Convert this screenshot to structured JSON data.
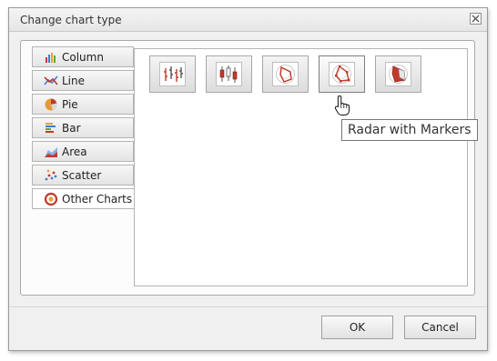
{
  "dialog": {
    "title": "Change chart type",
    "close_icon": "close-icon"
  },
  "tabs": [
    {
      "label": "Column",
      "icon": "column-chart-icon",
      "active": false
    },
    {
      "label": "Line",
      "icon": "line-chart-icon",
      "active": false
    },
    {
      "label": "Pie",
      "icon": "pie-chart-icon",
      "active": false
    },
    {
      "label": "Bar",
      "icon": "bar-chart-icon",
      "active": false
    },
    {
      "label": "Area",
      "icon": "area-chart-icon",
      "active": false
    },
    {
      "label": "Scatter",
      "icon": "scatter-chart-icon",
      "active": false
    },
    {
      "label": "Other Charts",
      "icon": "other-charts-icon",
      "active": true
    }
  ],
  "gallery": {
    "items": [
      {
        "icon": "stock-hlc-icon"
      },
      {
        "icon": "stock-candlestick-icon"
      },
      {
        "icon": "radar-icon"
      },
      {
        "icon": "radar-with-markers-icon",
        "hovered": true
      },
      {
        "icon": "filled-radar-icon"
      }
    ]
  },
  "tooltip": {
    "text": "Radar with Markers"
  },
  "footer": {
    "ok_label": "OK",
    "cancel_label": "Cancel"
  },
  "colors": {
    "accent_red": "#c0392b",
    "border": "#a9a9a9"
  }
}
